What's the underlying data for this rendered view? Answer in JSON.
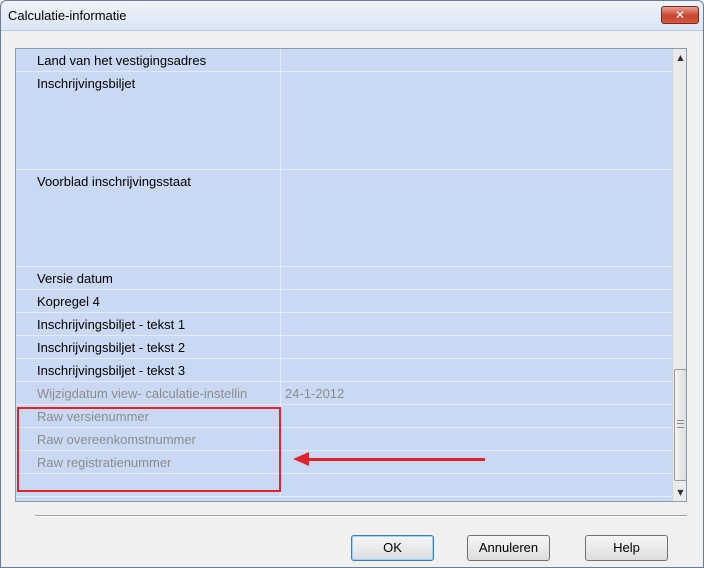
{
  "window": {
    "title": "Calculatie-informatie",
    "close_symbol": "✕"
  },
  "grid": {
    "rows": [
      {
        "name": "Land van het vestigingsadres",
        "value": "",
        "disabled": false
      },
      {
        "name": "Inschrijvingsbiljet",
        "value": "",
        "disabled": false
      },
      {
        "name": "Voorblad inschrijvingsstaat",
        "value": "",
        "disabled": false
      },
      {
        "name": "Versie datum",
        "value": "",
        "disabled": false
      },
      {
        "name": "Kopregel 4",
        "value": "",
        "disabled": false
      },
      {
        "name": "Inschrijvingsbiljet - tekst 1",
        "value": "",
        "disabled": false
      },
      {
        "name": "Inschrijvingsbiljet - tekst 2",
        "value": "",
        "disabled": false
      },
      {
        "name": "Inschrijvingsbiljet - tekst 3",
        "value": "",
        "disabled": false
      },
      {
        "name": "Wijzigdatum view- calculatie-instellin",
        "value": "24-1-2012",
        "disabled": true
      },
      {
        "name": "Raw versienummer",
        "value": "",
        "disabled": true
      },
      {
        "name": "Raw overeenkomstnummer",
        "value": "",
        "disabled": true
      },
      {
        "name": "Raw registratienummer",
        "value": "",
        "disabled": true
      }
    ]
  },
  "scrollbar": {
    "up_arrow": "▲",
    "down_arrow": "▼"
  },
  "buttons": {
    "ok": "OK",
    "cancel": "Annuleren",
    "help": "Help"
  },
  "colors": {
    "grid_background": "#c9d9f4",
    "annotation_red": "#e0222a"
  }
}
